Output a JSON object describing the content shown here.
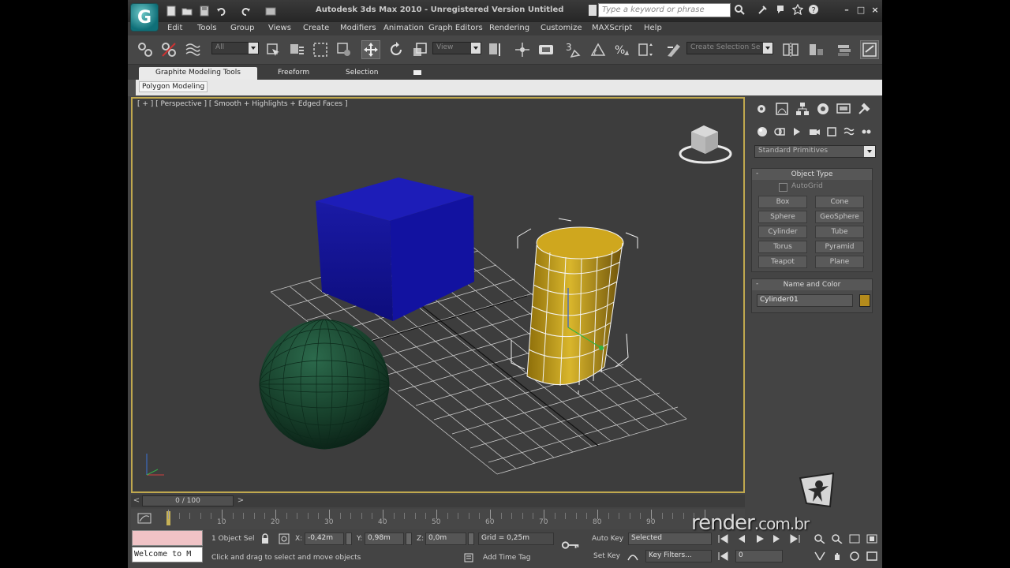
{
  "titlebar": {
    "title": "Autodesk 3ds Max  2010  - Unregistered Version    Untitled",
    "search_placeholder": "Type a keyword or phrase",
    "logo_letter": "G"
  },
  "menu": {
    "items": [
      "Edit",
      "Tools",
      "Group",
      "Views",
      "Create",
      "Modifiers",
      "Animation",
      "Graph Editors",
      "Rendering",
      "Customize",
      "MAXScript",
      "Help"
    ]
  },
  "toolbar": {
    "selection_filter": "All",
    "ref_coord": "View",
    "snap_label": "3",
    "named_selection": "Create Selection Se"
  },
  "ribbon": {
    "tabs": [
      "Graphite Modeling Tools",
      "Freeform",
      "Selection"
    ],
    "panel_tab": "Polygon Modeling"
  },
  "viewport": {
    "label": "[ + ] [ Perspective ] [ Smooth + Highlights + Edged Faces ]"
  },
  "command_panel": {
    "category": "Standard Primitives",
    "object_type": {
      "title": "Object Type",
      "autogrid": "AutoGrid",
      "buttons": [
        "Box",
        "Cone",
        "Sphere",
        "GeoSphere",
        "Cylinder",
        "Tube",
        "Torus",
        "Pyramid",
        "Teapot",
        "Plane"
      ]
    },
    "name_color": {
      "title": "Name and Color",
      "name": "Cylinder01",
      "color": "#b48b1c"
    }
  },
  "timeline": {
    "frame_display": "0 / 100",
    "ticks": [
      "10",
      "20",
      "30",
      "40",
      "50",
      "60",
      "70",
      "80",
      "90"
    ]
  },
  "status": {
    "maxscript_text": "Welcome to M",
    "selection": "1 Object Sel",
    "x_label": "X:",
    "x_value": "-0,42m",
    "y_label": "Y:",
    "y_value": "0,98m",
    "z_label": "Z:",
    "z_value": "0,0m",
    "grid": "Grid = 0,25m",
    "prompt": "Click and drag to select and move objects",
    "add_time_tag": "Add Time Tag",
    "auto_key": "Auto Key",
    "set_key": "Set Key",
    "key_mode": "Selected",
    "key_filters": "Key Filters...",
    "current_frame": "0"
  },
  "watermark": {
    "text_main": "render",
    "text_domain": ".com.br"
  },
  "colors": {
    "box": "#0d0d8a",
    "sphere": "#1f4a34",
    "cylinder": "#d6b21a",
    "viewport_border": "#c0a84e"
  }
}
